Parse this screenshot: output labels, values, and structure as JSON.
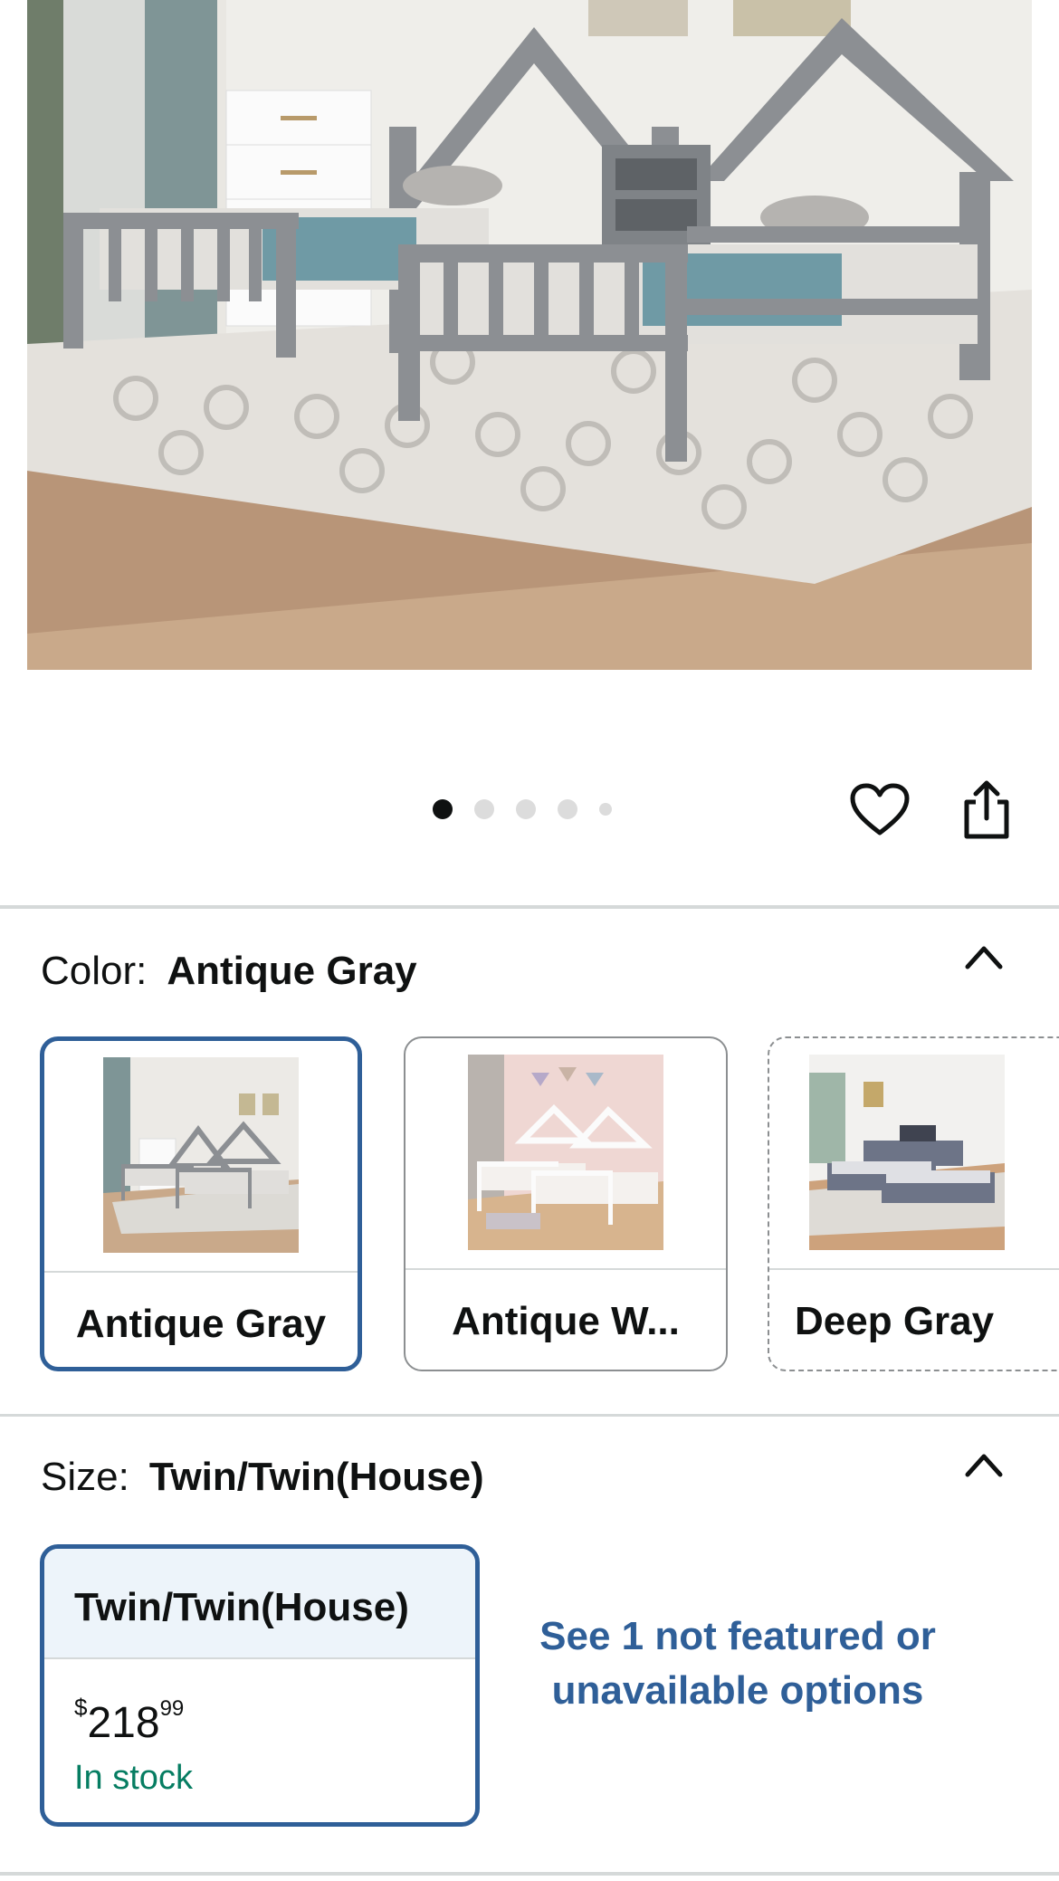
{
  "carousel": {
    "dot_count": 5,
    "active_index": 0,
    "icons": {
      "favorite": "heart-icon",
      "share": "share-icon"
    }
  },
  "color_section": {
    "label": "Color:",
    "selected_value": "Antique Gray",
    "collapse_icon": "chevron-up-icon",
    "options": [
      {
        "name": "Antique Gray",
        "state": "selected"
      },
      {
        "name": "Antique W...",
        "state": "available"
      },
      {
        "name": "Deep Gray",
        "state": "unavailable"
      }
    ]
  },
  "size_section": {
    "label": "Size:",
    "selected_value": "Twin/Twin(House)",
    "collapse_icon": "chevron-up-icon",
    "option": {
      "name": "Twin/Twin(House)",
      "price_symbol": "$",
      "price_whole": "218",
      "price_fraction": "99",
      "availability": "In stock"
    },
    "see_more_link": "See 1 not featured or unavailable options"
  },
  "colors": {
    "selected_border": "#2f5f98",
    "link": "#2f5f98",
    "in_stock": "#067d62",
    "divider": "#d5d9d9",
    "size_header_bg": "#edf4fa"
  }
}
